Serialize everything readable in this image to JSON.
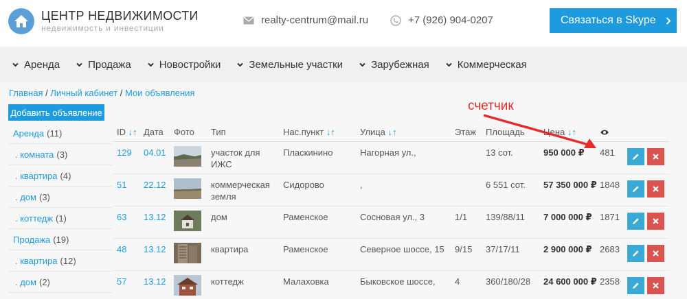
{
  "header": {
    "title": "ЦЕНТР НЕДВИЖИМОСТИ",
    "subtitle": "недвижимость и инвестиции",
    "email": "realty-centrum@mail.ru",
    "phone": "+7 (926) 904-0207",
    "skype_button": "Связаться в Skype",
    "icons": [
      "house-logo-icon",
      "envelope-icon",
      "phone-icon",
      "chevron-right-icon"
    ],
    "brand_color": "#1e9bde"
  },
  "nav": {
    "items": [
      "Аренда",
      "Продажа",
      "Новостройки",
      "Земельные участки",
      "Зарубежная",
      "Коммерческая"
    ]
  },
  "breadcrumb": {
    "home": "Главная",
    "sep": "/",
    "cabinet": "Личный кабинет",
    "current": "Мои объявления"
  },
  "add_button": "Добавить объявление",
  "sidebar": {
    "items": [
      {
        "label": "Аренда",
        "count": "(11)"
      },
      {
        "label": ". комната",
        "count": "(3)"
      },
      {
        "label": ". квартира",
        "count": "(4)"
      },
      {
        "label": ". дом",
        "count": "(3)"
      },
      {
        "label": ". коттедж",
        "count": "(1)"
      },
      {
        "label": "Продажа",
        "count": "(19)"
      },
      {
        "label": ". квартира",
        "count": "(12)"
      },
      {
        "label": ". дом",
        "count": "(2)"
      }
    ]
  },
  "table": {
    "headers": {
      "id": "ID",
      "sort": "↓↑",
      "date": "Дата",
      "photo": "Фото",
      "type": "Тип",
      "town": "Нас.пункт",
      "street": "Улица",
      "floor": "Этаж",
      "area": "Площадь",
      "price": "Цена",
      "views_icon": "eye-icon"
    },
    "rows": [
      {
        "id": "129",
        "date": "04.01",
        "type1": "участок для",
        "type2": "ИЖС",
        "town": "Пласкинино",
        "street": "Нагорная ул.,",
        "floor": "",
        "area": "13 сот.",
        "price": "950 000 ₽",
        "views": "481"
      },
      {
        "id": "51",
        "date": "22.12",
        "type1": "коммерческая",
        "type2": "земля",
        "town": "Сидорово",
        "street": ",",
        "floor": "",
        "area": "6 551 сот.",
        "price": "57 350 000 ₽",
        "views": "1848"
      },
      {
        "id": "63",
        "date": "13.12",
        "type1": "дом",
        "type2": "",
        "town": "Раменское",
        "street": "Сосновая ул., 3",
        "floor": "1/1",
        "area": "139/88/11",
        "price": "7 000 000 ₽",
        "views": "1871"
      },
      {
        "id": "48",
        "date": "13.12",
        "type1": "квартира",
        "type2": "",
        "town": "Раменское",
        "street": "Северное шоссе, 15",
        "floor": "9/15",
        "area": "37/17/11",
        "price": "2 900 000 ₽",
        "views": "2683"
      },
      {
        "id": "57",
        "date": "13.12",
        "type1": "коттедж",
        "type2": "",
        "town": "Малаховка",
        "street": "Быковское шоссе,",
        "floor": "4",
        "area": "360/180/28",
        "price": "24 600 000 ₽",
        "views": "2358"
      }
    ]
  },
  "annotation": {
    "label": "счетчик",
    "color": "#e52b2b"
  }
}
